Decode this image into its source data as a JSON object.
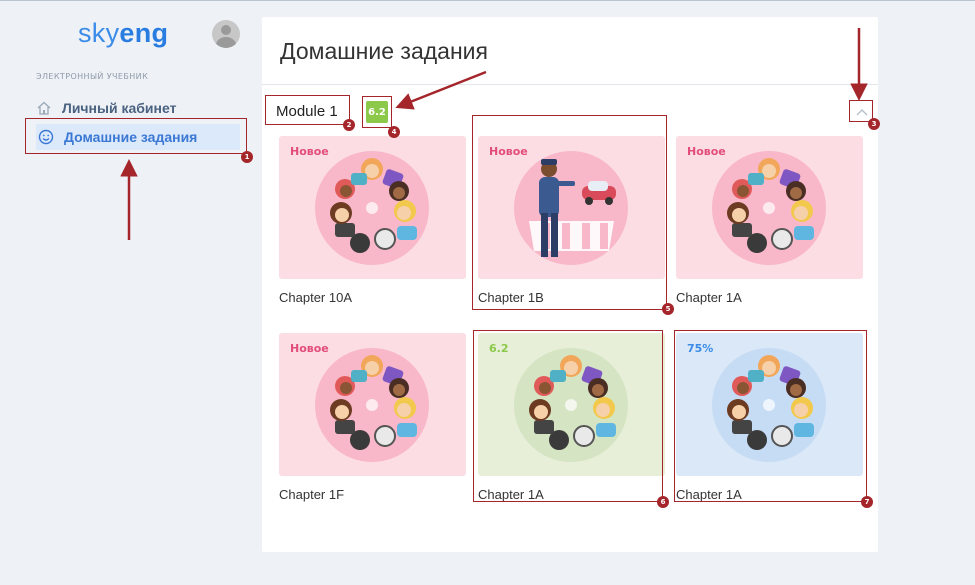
{
  "brand": {
    "name_plain": "sky",
    "name_bold": "eng"
  },
  "sidebar": {
    "section_label": "ЭЛЕКТРОННЫЙ УЧЕБНИК",
    "items": [
      {
        "label": "Личный кабинет",
        "icon": "home-icon"
      },
      {
        "label": "Домашние задания",
        "icon": "smiley-icon"
      }
    ]
  },
  "main": {
    "title": "Домашние задания",
    "module": {
      "title": "Module 1",
      "score": "6.2"
    }
  },
  "cards": [
    {
      "caption": "Chapter 10A",
      "tag": "Новое",
      "illustration": "kids-circle",
      "theme": "pink"
    },
    {
      "caption": "Chapter 1B",
      "tag": "Новое",
      "illustration": "policeman-crosswalk",
      "theme": "pink"
    },
    {
      "caption": "Chapter 1A",
      "tag": "Новое",
      "illustration": "kids-circle",
      "theme": "pink"
    },
    {
      "caption": "Chapter 1F",
      "tag": "Новое",
      "illustration": "kids-circle",
      "theme": "pink"
    },
    {
      "caption": "Chapter 1A",
      "tag": "6.2",
      "illustration": "kids-circle",
      "theme": "green"
    },
    {
      "caption": "Chapter 1A",
      "tag": "75%",
      "illustration": "kids-circle",
      "theme": "blue"
    }
  ],
  "annotations": [
    "1",
    "2",
    "3",
    "4",
    "5",
    "6",
    "7"
  ],
  "colors": {
    "accent": "#3b8ce8",
    "new_tag": "#e24d7b",
    "score_green": "#8cc94a",
    "progress_blue": "#3b8ce8",
    "annotation_red": "#a4252a"
  }
}
